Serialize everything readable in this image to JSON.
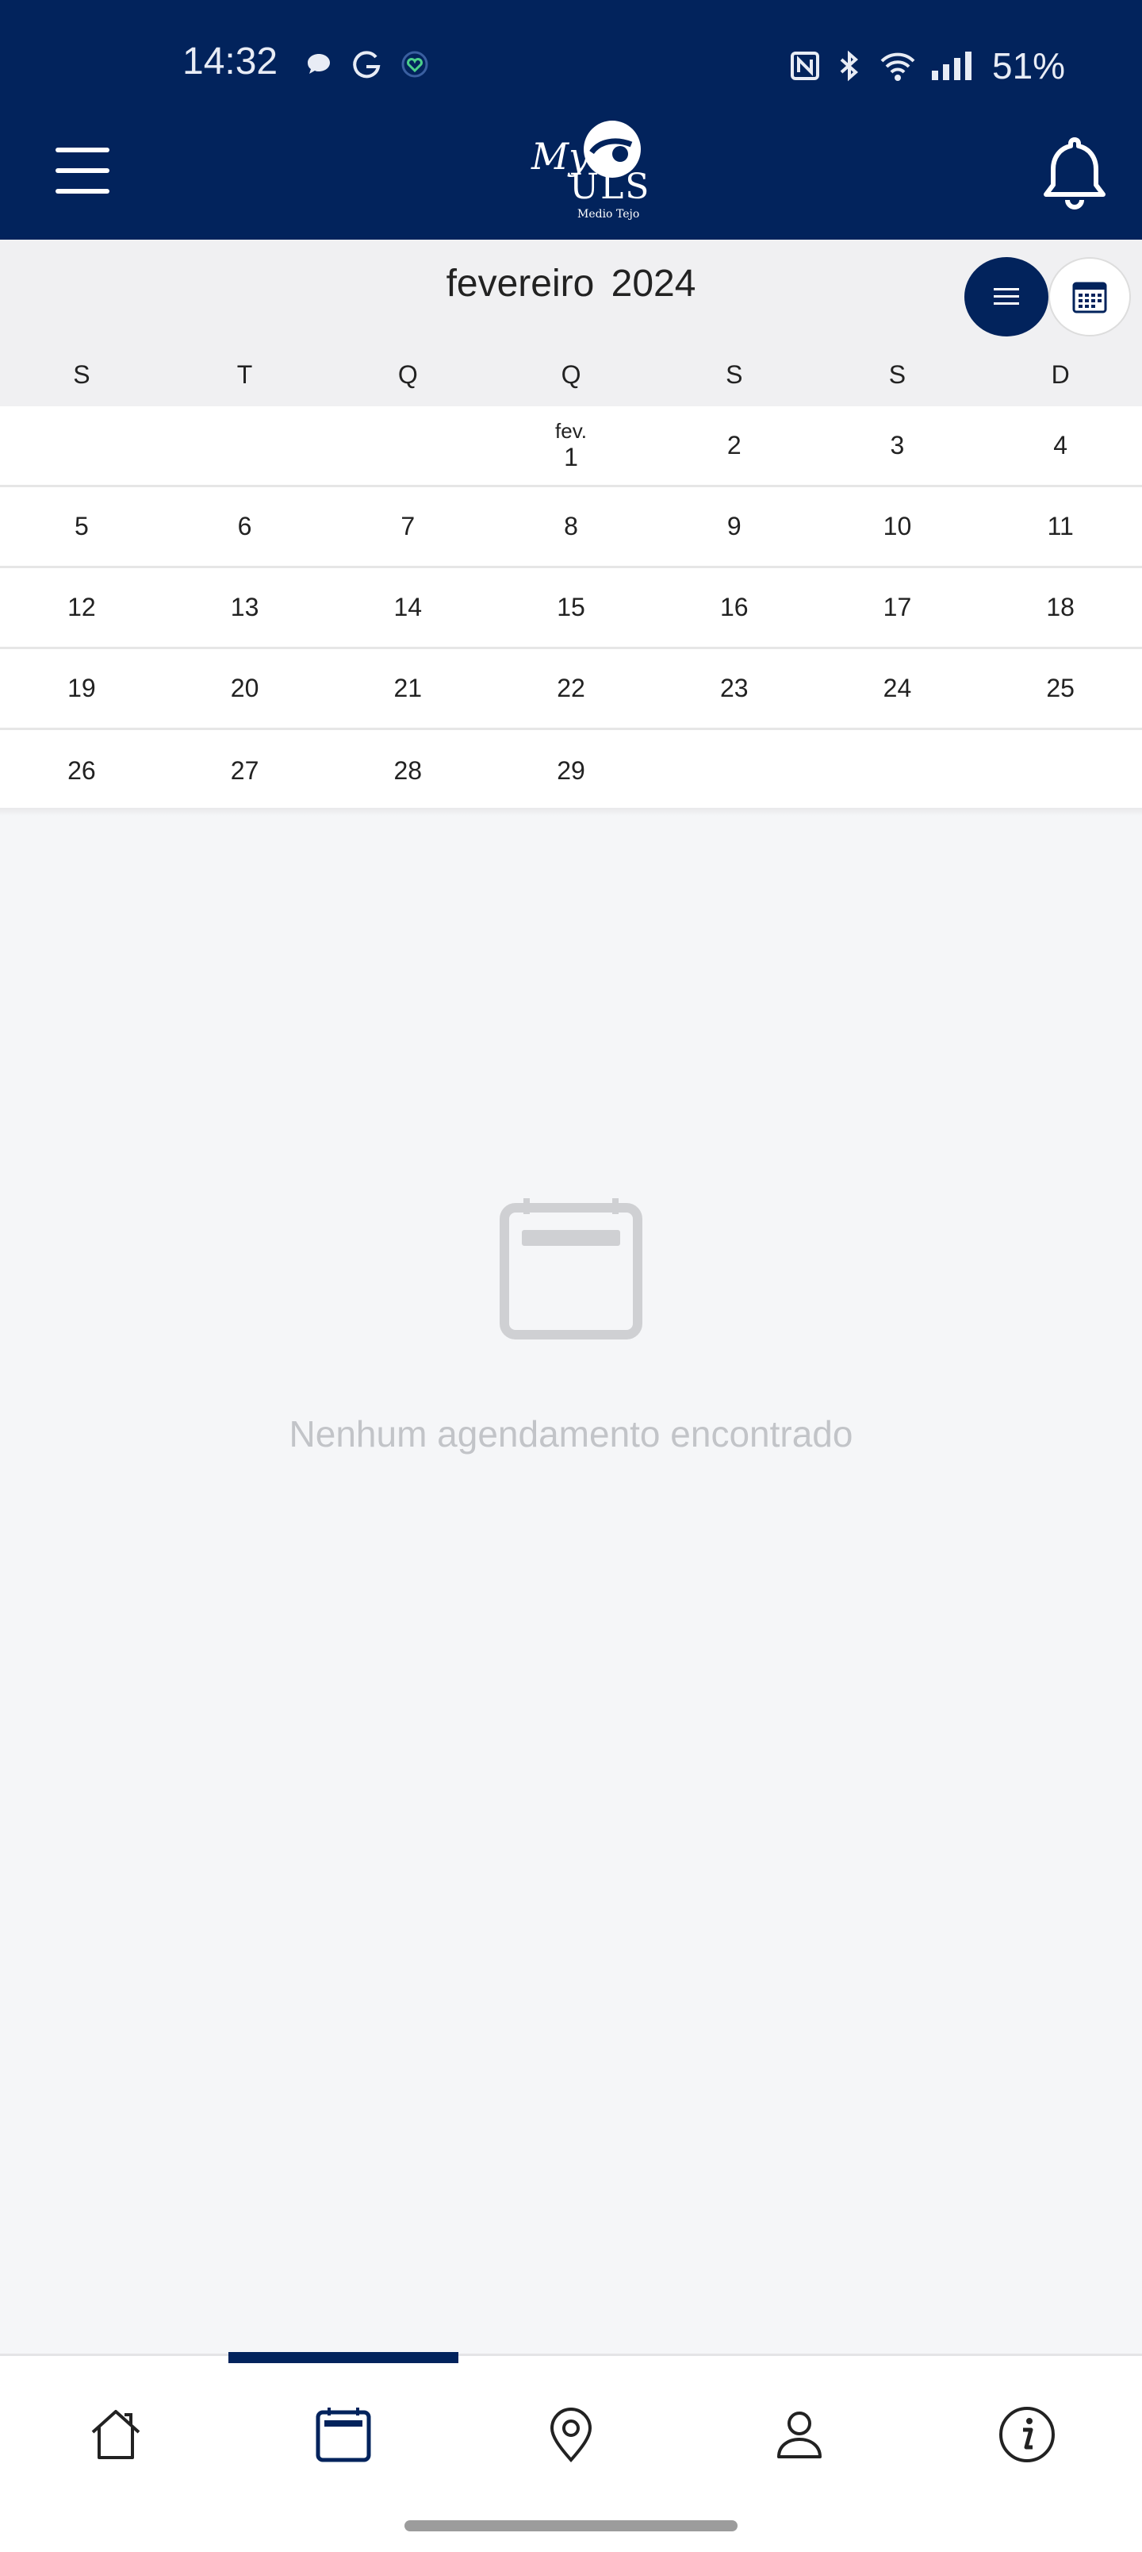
{
  "status_bar": {
    "time": "14:32",
    "battery": "51%",
    "left_icons": [
      "chat-bubble-icon",
      "google-icon",
      "heart-shield-icon"
    ],
    "right_icons": [
      "nfc-icon",
      "bluetooth-icon",
      "wifi-icon",
      "signal-icon"
    ]
  },
  "header": {
    "logo_my": "My",
    "logo_uls": "ULS",
    "logo_sub": "Medio Tejo",
    "menu_icon": "hamburger-icon",
    "bell_icon": "bell-icon"
  },
  "calendar": {
    "month_title": "fevereiro  2024",
    "weekdays": [
      "S",
      "T",
      "Q",
      "Q",
      "S",
      "S",
      "D"
    ],
    "weeks": [
      [
        {
          "day": ""
        },
        {
          "day": ""
        },
        {
          "day": ""
        },
        {
          "day": "1",
          "month_abbr": "fev."
        },
        {
          "day": "2"
        },
        {
          "day": "3"
        },
        {
          "day": "4"
        }
      ],
      [
        {
          "day": "5"
        },
        {
          "day": "6"
        },
        {
          "day": "7"
        },
        {
          "day": "8"
        },
        {
          "day": "9"
        },
        {
          "day": "10"
        },
        {
          "day": "11"
        }
      ],
      [
        {
          "day": "12"
        },
        {
          "day": "13"
        },
        {
          "day": "14"
        },
        {
          "day": "15"
        },
        {
          "day": "16"
        },
        {
          "day": "17"
        },
        {
          "day": "18"
        }
      ],
      [
        {
          "day": "19"
        },
        {
          "day": "20"
        },
        {
          "day": "21"
        },
        {
          "day": "22"
        },
        {
          "day": "23"
        },
        {
          "day": "24"
        },
        {
          "day": "25"
        }
      ],
      [
        {
          "day": "26"
        },
        {
          "day": "27"
        },
        {
          "day": "28"
        },
        {
          "day": "29"
        },
        {
          "day": ""
        },
        {
          "day": ""
        },
        {
          "day": ""
        }
      ]
    ]
  },
  "empty_state": {
    "message": "Nenhum agendamento encontrado",
    "icon": "calendar-empty-icon"
  },
  "bottom_nav": {
    "active_index": 1,
    "items": [
      {
        "icon": "home-icon"
      },
      {
        "icon": "calendar-icon"
      },
      {
        "icon": "location-pin-icon"
      },
      {
        "icon": "user-icon"
      },
      {
        "icon": "info-icon"
      }
    ]
  },
  "colors": {
    "brand_navy": "#02235c",
    "background": "#f5f6f8",
    "empty_text": "#c2c4c8"
  }
}
